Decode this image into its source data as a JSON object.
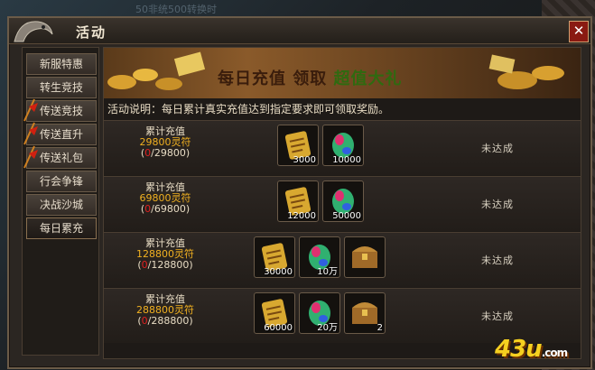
{
  "background": {
    "top_text": "50非统500转换时"
  },
  "window": {
    "title": "活动",
    "close_label": "✕"
  },
  "sidebar": {
    "items": [
      {
        "label": "新服特惠",
        "flag": false,
        "active": false
      },
      {
        "label": "转生竞技",
        "flag": false,
        "active": false
      },
      {
        "label": "传送竞技",
        "flag": true,
        "active": false
      },
      {
        "label": "传送直升",
        "flag": true,
        "active": false
      },
      {
        "label": "传送礼包",
        "flag": true,
        "active": false
      },
      {
        "label": "行会争锋",
        "flag": false,
        "active": false
      },
      {
        "label": "决战沙城",
        "flag": false,
        "active": false
      },
      {
        "label": "每日累充",
        "flag": false,
        "active": true
      }
    ]
  },
  "banner": {
    "part1": "每日充值 领取 ",
    "part2": "超值大礼"
  },
  "description": "活动说明：每日累计真实充值达到指定要求即可领取奖励。",
  "rows": [
    {
      "title": "累计充值",
      "amount": "29800灵符",
      "progress_current": "0",
      "progress_total": "/29800",
      "rewards": [
        {
          "icon": "scroll-icon",
          "count": "3000"
        },
        {
          "icon": "gem-icon",
          "count": "10000"
        }
      ],
      "status": "未达成"
    },
    {
      "title": "累计充值",
      "amount": "69800灵符",
      "progress_current": "0",
      "progress_total": "/69800",
      "rewards": [
        {
          "icon": "scroll-icon",
          "count": "12000"
        },
        {
          "icon": "gem-icon",
          "count": "50000"
        }
      ],
      "status": "未达成"
    },
    {
      "title": "累计充值",
      "amount": "128800灵符",
      "progress_current": "0",
      "progress_total": "/128800",
      "rewards": [
        {
          "icon": "scroll-icon",
          "count": "30000"
        },
        {
          "icon": "gem-icon",
          "count": "10万"
        },
        {
          "icon": "chest-icon",
          "count": ""
        }
      ],
      "status": "未达成"
    },
    {
      "title": "累计充值",
      "amount": "288800灵符",
      "progress_current": "0",
      "progress_total": "/288800",
      "rewards": [
        {
          "icon": "scroll-icon",
          "count": "60000"
        },
        {
          "icon": "gem-icon",
          "count": "20万"
        },
        {
          "icon": "chest-icon",
          "count": "2"
        }
      ],
      "status": "未达成"
    }
  ],
  "watermark": {
    "logo": "43u",
    "suffix": ".com"
  },
  "colors": {
    "amount": "#f0b020",
    "progress_red": "#e02020",
    "close_bg": "#8a1a12"
  }
}
